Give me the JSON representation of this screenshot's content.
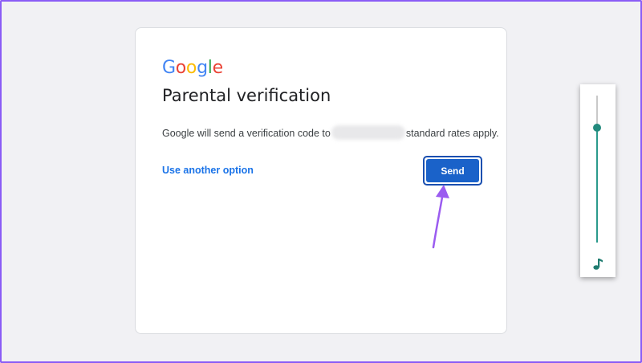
{
  "brand": {
    "logo_letters": [
      "G",
      "o",
      "o",
      "g",
      "l",
      "e"
    ]
  },
  "dialog": {
    "title": "Parental verification",
    "description_prefix": "Google will send a verification code to",
    "description_suffix": "standard rates apply.",
    "alt_option_label": "Use another option",
    "send_label": "Send"
  },
  "volume": {
    "level_percent": 78,
    "icon": "music-note-icon"
  },
  "colors": {
    "accent_blue": "#1a62c9",
    "link_blue": "#1a73e8",
    "highlight_purple": "#8a5cf6",
    "slider_teal": "#2a9a8c"
  }
}
